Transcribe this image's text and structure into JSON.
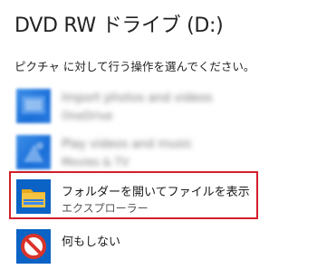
{
  "dialog": {
    "title": "DVD RW ドライブ (D:)",
    "subtitle": "ピクチャ に対して行う操作を選んでください。"
  },
  "options": [
    {
      "label": "Import photos and videos",
      "sub": "OneDrive",
      "icon": "app-tile-icon",
      "blurred": true
    },
    {
      "label": "Play videos and music",
      "sub": "Movies & TV",
      "icon": "app-tile-icon",
      "blurred": true
    },
    {
      "label": "フォルダーを開いてファイルを表示",
      "sub": "エクスプローラー",
      "icon": "folder-icon",
      "blurred": false,
      "highlighted": true
    },
    {
      "label": "何もしない",
      "sub": "",
      "icon": "no-action-icon",
      "blurred": false
    }
  ],
  "colors": {
    "highlight_border": "#d31f2b",
    "tile_blue": "#0b63c5",
    "folder_yellow": "#f6c343",
    "no_action_red": "#d9332b"
  }
}
